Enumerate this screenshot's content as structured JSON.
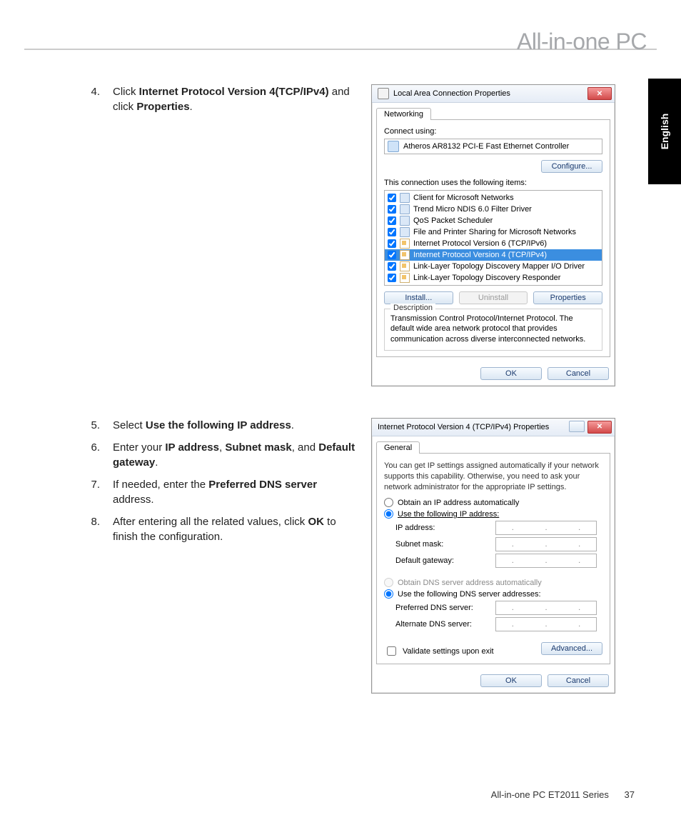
{
  "header": {
    "title": "All-in-one PC",
    "language_tab": "English"
  },
  "steps_a": [
    {
      "n": "4.",
      "html": "Click <b>Internet Protocol Version 4(TCP/IPv4)</b> and click <b>Properties</b>."
    }
  ],
  "steps_b": [
    {
      "n": "5.",
      "html": "Select <b>Use the following IP address</b>."
    },
    {
      "n": "6.",
      "html": "Enter your <b>IP address</b>, <b>Subnet mask</b>, and <b>Default gateway</b>."
    },
    {
      "n": "7.",
      "html": "If needed, enter the <b>Preferred DNS server</b> address."
    },
    {
      "n": "8.",
      "html": "After entering all the related values, click <b>OK</b> to finish the configuration."
    }
  ],
  "dlg1": {
    "title": "Local Area Connection Properties",
    "tab": "Networking",
    "connect_using_label": "Connect using:",
    "adapter": "Atheros AR8132 PCI-E Fast Ethernet Controller",
    "configure_btn": "Configure...",
    "items_label": "This connection uses the following items:",
    "items": [
      {
        "label": "Client for Microsoft Networks",
        "icon": "svc",
        "checked": true,
        "sel": false
      },
      {
        "label": "Trend Micro NDIS 6.0 Filter Driver",
        "icon": "svc",
        "checked": true,
        "sel": false
      },
      {
        "label": "QoS Packet Scheduler",
        "icon": "svc",
        "checked": true,
        "sel": false
      },
      {
        "label": "File and Printer Sharing for Microsoft Networks",
        "icon": "svc",
        "checked": true,
        "sel": false
      },
      {
        "label": "Internet Protocol Version 6 (TCP/IPv6)",
        "icon": "proto",
        "checked": true,
        "sel": false
      },
      {
        "label": "Internet Protocol Version 4 (TCP/IPv4)",
        "icon": "proto",
        "checked": true,
        "sel": true
      },
      {
        "label": "Link-Layer Topology Discovery Mapper I/O Driver",
        "icon": "proto",
        "checked": true,
        "sel": false
      },
      {
        "label": "Link-Layer Topology Discovery Responder",
        "icon": "proto",
        "checked": true,
        "sel": false
      }
    ],
    "install_btn": "Install...",
    "uninstall_btn": "Uninstall",
    "properties_btn": "Properties",
    "desc_legend": "Description",
    "description": "Transmission Control Protocol/Internet Protocol. The default wide area network protocol that provides communication across diverse interconnected networks.",
    "ok_btn": "OK",
    "cancel_btn": "Cancel"
  },
  "dlg2": {
    "title": "Internet Protocol Version 4 (TCP/IPv4) Properties",
    "tab": "General",
    "hint": "You can get IP settings assigned automatically if your network supports this capability. Otherwise, you need to ask your network administrator for the appropriate IP settings.",
    "r_obtain_ip": "Obtain an IP address automatically",
    "r_use_ip": "Use the following IP address:",
    "ip_address_label": "IP address:",
    "subnet_label": "Subnet mask:",
    "gateway_label": "Default gateway:",
    "r_obtain_dns": "Obtain DNS server address automatically",
    "r_use_dns": "Use the following DNS server addresses:",
    "pref_dns_label": "Preferred DNS server:",
    "alt_dns_label": "Alternate DNS server:",
    "validate_label": "Validate settings upon exit",
    "advanced_btn": "Advanced...",
    "ok_btn": "OK",
    "cancel_btn": "Cancel"
  },
  "footer": {
    "series": "All-in-one PC ET2011 Series",
    "page": "37"
  }
}
